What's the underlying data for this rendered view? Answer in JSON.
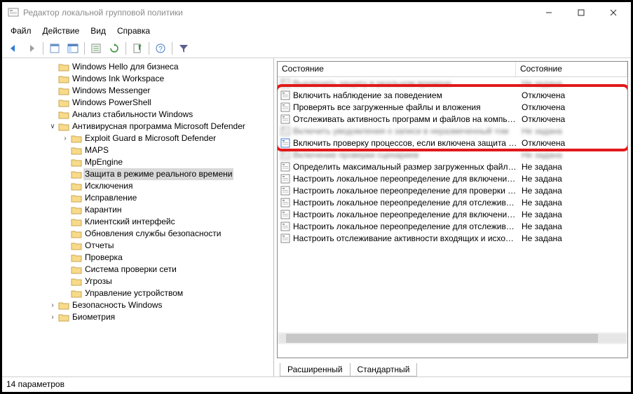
{
  "window_title": "Редактор локальной групповой политики",
  "menu": [
    "Файл",
    "Действие",
    "Вид",
    "Справка"
  ],
  "tree": [
    {
      "label": "Windows Hello для бизнеса",
      "depth": 0,
      "exp": ""
    },
    {
      "label": "Windows Ink Workspace",
      "depth": 0,
      "exp": ""
    },
    {
      "label": "Windows Messenger",
      "depth": 0,
      "exp": ""
    },
    {
      "label": "Windows PowerShell",
      "depth": 0,
      "exp": ""
    },
    {
      "label": "Анализ стабильности Windows",
      "depth": 0,
      "exp": ""
    },
    {
      "label": "Антивирусная программа Microsoft Defender",
      "depth": 0,
      "exp": "v",
      "expSym": "∨",
      "before": true
    },
    {
      "label": "Exploit Guard в Microsoft Defender",
      "depth": 1,
      "exp": ">"
    },
    {
      "label": "MAPS",
      "depth": 1,
      "exp": ""
    },
    {
      "label": "MpEngine",
      "depth": 1,
      "exp": ""
    },
    {
      "label": "Защита в режиме реального времени",
      "depth": 1,
      "exp": "",
      "selected": true
    },
    {
      "label": "Исключения",
      "depth": 1,
      "exp": ""
    },
    {
      "label": "Исправление",
      "depth": 1,
      "exp": ""
    },
    {
      "label": "Карантин",
      "depth": 1,
      "exp": ""
    },
    {
      "label": "Клиентский интерфейс",
      "depth": 1,
      "exp": ""
    },
    {
      "label": "Обновления службы безопасности",
      "depth": 1,
      "exp": ""
    },
    {
      "label": "Отчеты",
      "depth": 1,
      "exp": ""
    },
    {
      "label": "Проверка",
      "depth": 1,
      "exp": ""
    },
    {
      "label": "Система проверки сети",
      "depth": 1,
      "exp": ""
    },
    {
      "label": "Угрозы",
      "depth": 1,
      "exp": ""
    },
    {
      "label": "Управление устройством",
      "depth": 1,
      "exp": ""
    },
    {
      "label": "Безопасность Windows",
      "depth": 0,
      "exp": ">"
    },
    {
      "label": "Биометрия",
      "depth": 0,
      "exp": ">"
    }
  ],
  "columns": {
    "c1": "Состояние",
    "c2": "Состояние"
  },
  "list": [
    {
      "name": "Выключить защиту в реальном времени",
      "state": "Не задана",
      "blur": true
    },
    {
      "name": "Включить наблюдение за поведением",
      "state": "Отключена"
    },
    {
      "name": "Проверять все загруженные файлы и вложения",
      "state": "Отключена"
    },
    {
      "name": "Отслеживать активность программ и файлов на компью...",
      "state": "Отключена"
    },
    {
      "name": "Включить уведомления о записи в неразмеченный том",
      "state": "Не задана",
      "blur": true
    },
    {
      "name": "Включить проверку процессов, если включена защита в ...",
      "state": "Отключена",
      "iconBlue": true
    },
    {
      "name": "Включение проверки сценариев",
      "state": "Не задана",
      "blur": true
    },
    {
      "name": "Определить максимальный размер загруженных файло...",
      "state": "Не задана"
    },
    {
      "name": "Настроить локальное переопределение для включения к...",
      "state": "Не задана"
    },
    {
      "name": "Настроить локальное переопределение для проверки вс...",
      "state": "Не задана"
    },
    {
      "name": "Настроить локальное переопределение для отслеживан...",
      "state": "Не задана"
    },
    {
      "name": "Настроить локальное переопределение для включения з...",
      "state": "Не задана"
    },
    {
      "name": "Настроить локальное переопределение для отслеживан...",
      "state": "Не задана"
    },
    {
      "name": "Настроить отслеживание активности входящих и исходя...",
      "state": "Не задана"
    }
  ],
  "tabs": [
    "Расширенный",
    "Стандартный"
  ],
  "statusbar": "14 параметров"
}
